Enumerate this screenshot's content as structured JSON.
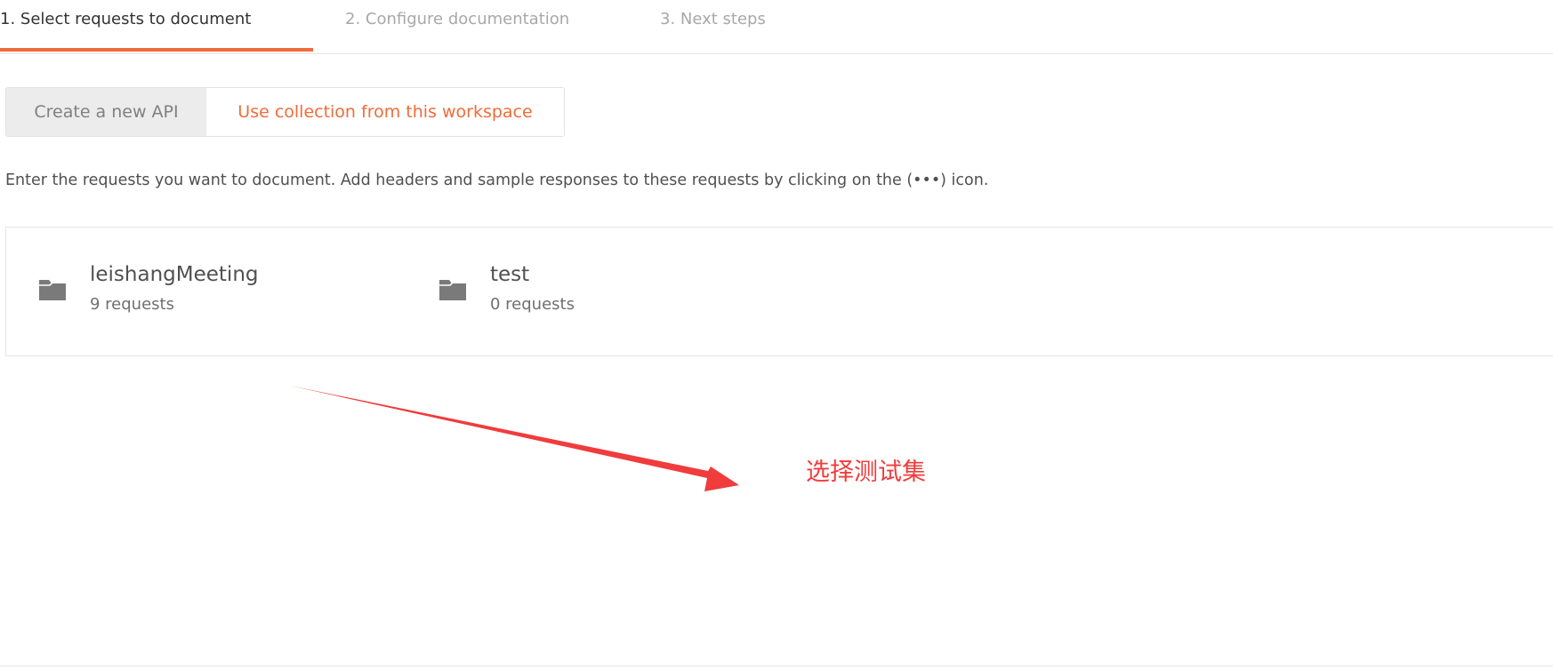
{
  "steps": [
    {
      "label": "1. Select requests to document",
      "active": true
    },
    {
      "label": "2. Configure documentation",
      "active": false
    },
    {
      "label": "3. Next steps",
      "active": false
    }
  ],
  "source_toggle": {
    "create_new": "Create a new API",
    "use_collection": "Use collection from this workspace",
    "selected": "use_collection"
  },
  "instructions": "Enter the requests you want to document. Add headers and sample responses to these requests by clicking on the (•••) icon.",
  "collections": [
    {
      "name": "leishangMeeting",
      "count": "9 requests",
      "icon": "folder-icon"
    },
    {
      "name": "test",
      "count": "0 requests",
      "icon": "folder-icon"
    }
  ],
  "annotation": {
    "text": "选择测试集",
    "color": "#f03c3c"
  },
  "colors": {
    "accent": "#f26b3a",
    "annotation": "#f03c3c"
  }
}
